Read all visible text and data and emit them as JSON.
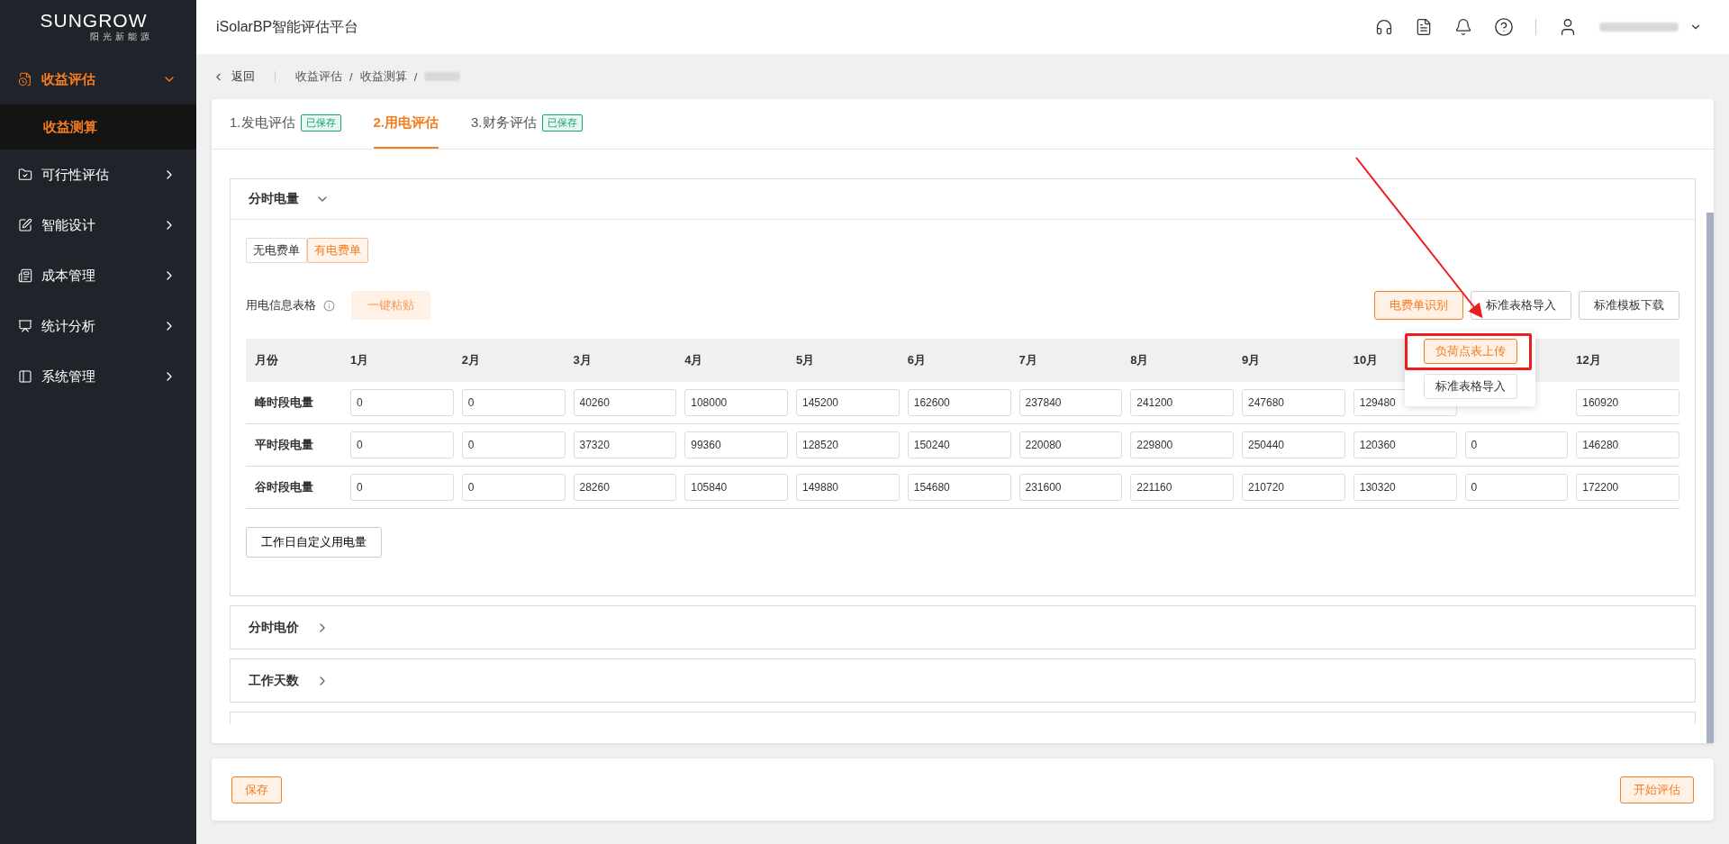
{
  "sidebar": {
    "logo": "SUNGROW",
    "logo_subtitle": "阳光新能源",
    "items": [
      {
        "label": "收益评估",
        "expanded": true,
        "selected": true,
        "children": [
          {
            "label": "收益测算",
            "selected": true
          }
        ]
      },
      {
        "label": "可行性评估",
        "expanded": false,
        "selected": false
      },
      {
        "label": "智能设计",
        "expanded": false,
        "selected": false
      },
      {
        "label": "成本管理",
        "expanded": false,
        "selected": false
      },
      {
        "label": "统计分析",
        "expanded": false,
        "selected": false
      },
      {
        "label": "系统管理",
        "expanded": false,
        "selected": false
      }
    ]
  },
  "header": {
    "title": "iSolarBP智能评估平台"
  },
  "breadcrumb": {
    "back": "返回",
    "separator": "/",
    "items": [
      "收益评估",
      "收益测算"
    ]
  },
  "tabs": [
    {
      "label": "1.发电评估",
      "badge": "已保存",
      "selected": false
    },
    {
      "label": "2.用电评估",
      "selected": true
    },
    {
      "label": "3.财务评估",
      "badge": "已保存",
      "selected": false
    }
  ],
  "panels": [
    {
      "title": "分时电量",
      "expanded": true
    },
    {
      "title": "分时电价",
      "expanded": false
    },
    {
      "title": "工作天数",
      "expanded": false
    }
  ],
  "bill_toggle": [
    {
      "label": "无电费单",
      "selected": false
    },
    {
      "label": "有电费单",
      "selected": true
    }
  ],
  "table_label": "用电信息表格",
  "paste_button": "一键粘贴",
  "actions": [
    {
      "label": "电费单识别",
      "kind": "primary"
    },
    {
      "label": "标准表格导入",
      "kind": "default"
    },
    {
      "label": "标准模板下载",
      "kind": "default"
    }
  ],
  "dropdown": [
    {
      "label": "负荷点表上传",
      "selected": true
    },
    {
      "label": "标准表格导入",
      "selected": false
    }
  ],
  "table": {
    "row_header": "月份",
    "columns": [
      {
        "label": "1月"
      },
      {
        "label": "2月"
      },
      {
        "label": "3月"
      },
      {
        "label": "4月"
      },
      {
        "label": "5月"
      },
      {
        "label": "6月"
      },
      {
        "label": "7月"
      },
      {
        "label": "8月"
      },
      {
        "label": "9月"
      },
      {
        "label": "10月"
      },
      {
        "hidden": true
      },
      {
        "label": "12月"
      }
    ],
    "rows": [
      {
        "label": "峰时段电量",
        "cells": [
          {
            "value": "0"
          },
          {
            "value": "0"
          },
          {
            "value": "40260"
          },
          {
            "value": "108000"
          },
          {
            "value": "145200"
          },
          {
            "value": "162600"
          },
          {
            "value": "237840"
          },
          {
            "value": "241200"
          },
          {
            "value": "247680"
          },
          {
            "value": "129480"
          },
          {
            "hidden": true
          },
          {
            "value": "160920"
          }
        ]
      },
      {
        "label": "平时段电量",
        "cells": [
          {
            "value": "0"
          },
          {
            "value": "0"
          },
          {
            "value": "37320"
          },
          {
            "value": "99360"
          },
          {
            "value": "128520"
          },
          {
            "value": "150240"
          },
          {
            "value": "220080"
          },
          {
            "value": "229800"
          },
          {
            "value": "250440"
          },
          {
            "value": "120360"
          },
          {
            "value": "0"
          },
          {
            "value": "146280"
          }
        ]
      },
      {
        "label": "谷时段电量",
        "cells": [
          {
            "value": "0"
          },
          {
            "value": "0"
          },
          {
            "value": "28260"
          },
          {
            "value": "105840"
          },
          {
            "value": "149880"
          },
          {
            "value": "154680"
          },
          {
            "value": "231600"
          },
          {
            "value": "221160"
          },
          {
            "value": "210720"
          },
          {
            "value": "130320"
          },
          {
            "value": "0"
          },
          {
            "value": "172200"
          }
        ]
      }
    ]
  },
  "custom_button": "工作日自定义用电量",
  "footer": {
    "save": "保存",
    "start": "开始评估"
  }
}
